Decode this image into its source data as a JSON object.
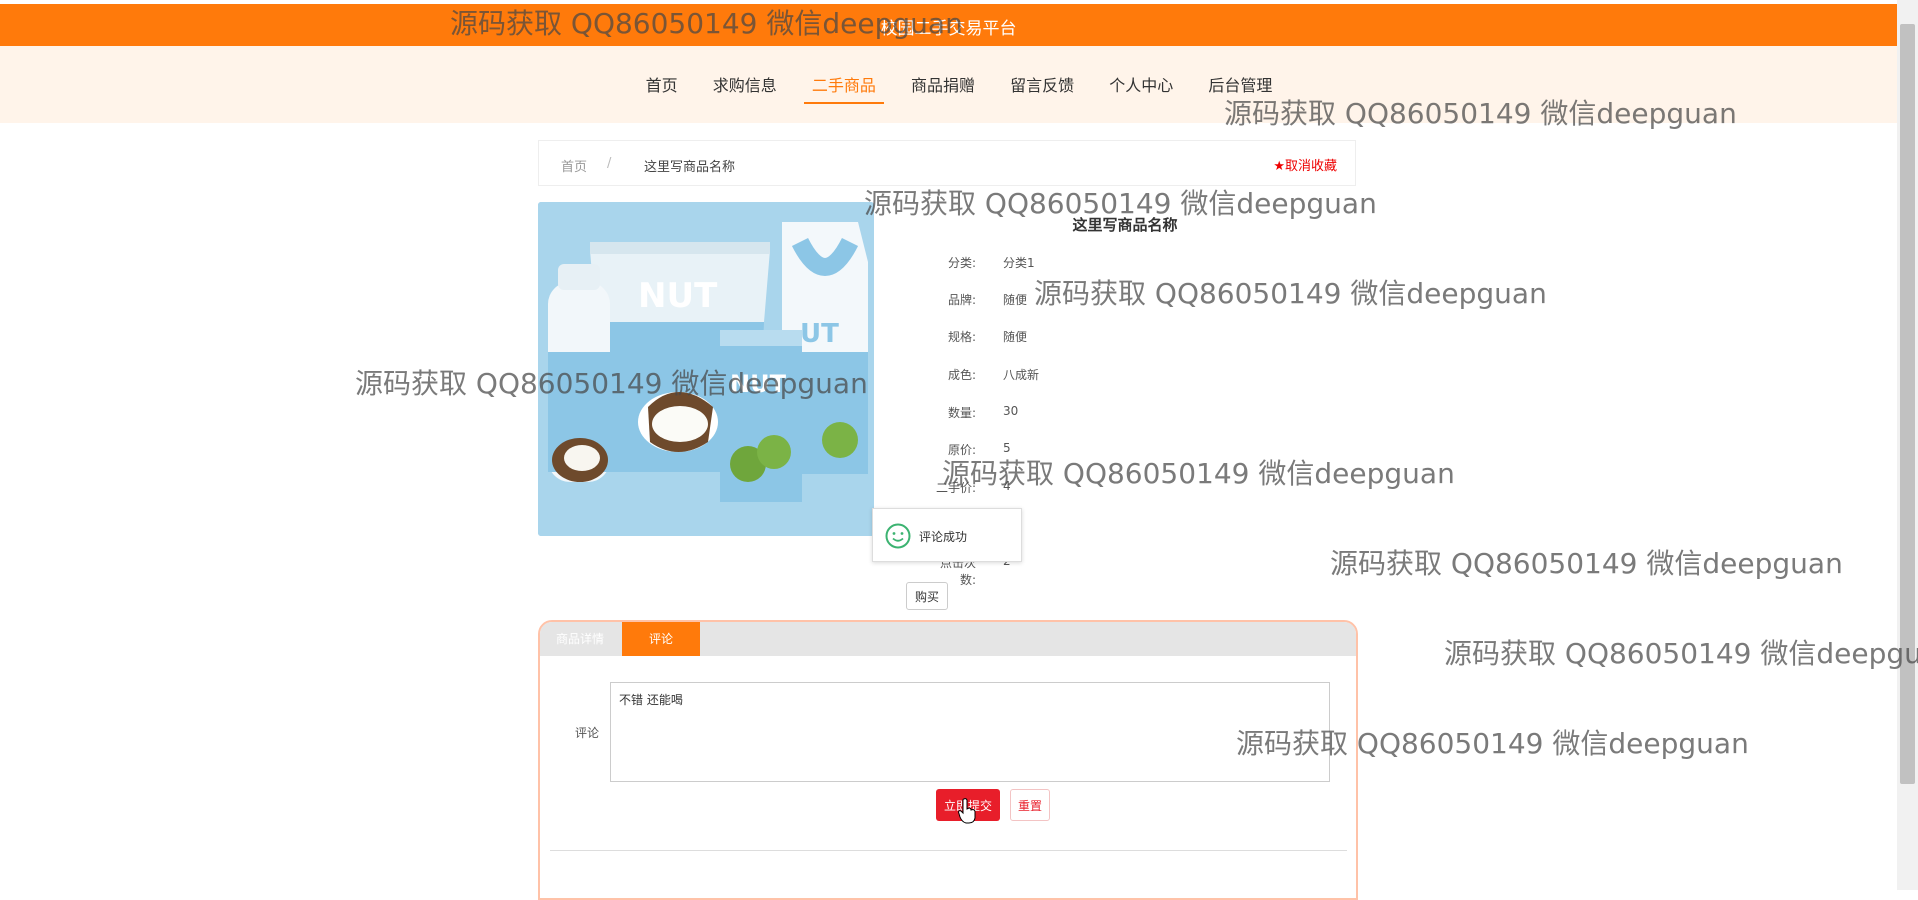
{
  "header": {
    "site_title": "校园二手交易平台"
  },
  "nav": {
    "items": [
      "首页",
      "求购信息",
      "二手商品",
      "商品捐赠",
      "留言反馈",
      "个人中心",
      "后台管理"
    ],
    "active_index": 2
  },
  "breadcrumb": {
    "home": "首页",
    "separator": "/",
    "current": "这里写商品名称"
  },
  "favorite": {
    "label": "取消收藏"
  },
  "product": {
    "name": "这里写商品名称",
    "image_text": "NUT",
    "fields": [
      {
        "label": "分类:",
        "value": "分类1"
      },
      {
        "label": "品牌:",
        "value": "随便"
      },
      {
        "label": "规格:",
        "value": "随便"
      },
      {
        "label": "成色:",
        "value": "八成新"
      },
      {
        "label": "数量:",
        "value": "30"
      },
      {
        "label": "原价:",
        "value": "5"
      },
      {
        "label": "二手价:",
        "value": "4"
      },
      {
        "label": "点击次数:",
        "value": "2"
      }
    ],
    "buy_label": "购买"
  },
  "toast": {
    "message": "评论成功"
  },
  "tabs": [
    {
      "label": "商品详情"
    },
    {
      "label": "评论"
    }
  ],
  "comment": {
    "label": "评论",
    "value": "不错 还能喝",
    "submit_label": "立即提交",
    "reset_label": "重置"
  },
  "watermark": {
    "text": "源码获取 QQ86050149 微信deepguan"
  },
  "colors": {
    "accent": "#ff7a0b",
    "nav_bg": "#fff4ea",
    "danger": "#e81e2a"
  }
}
